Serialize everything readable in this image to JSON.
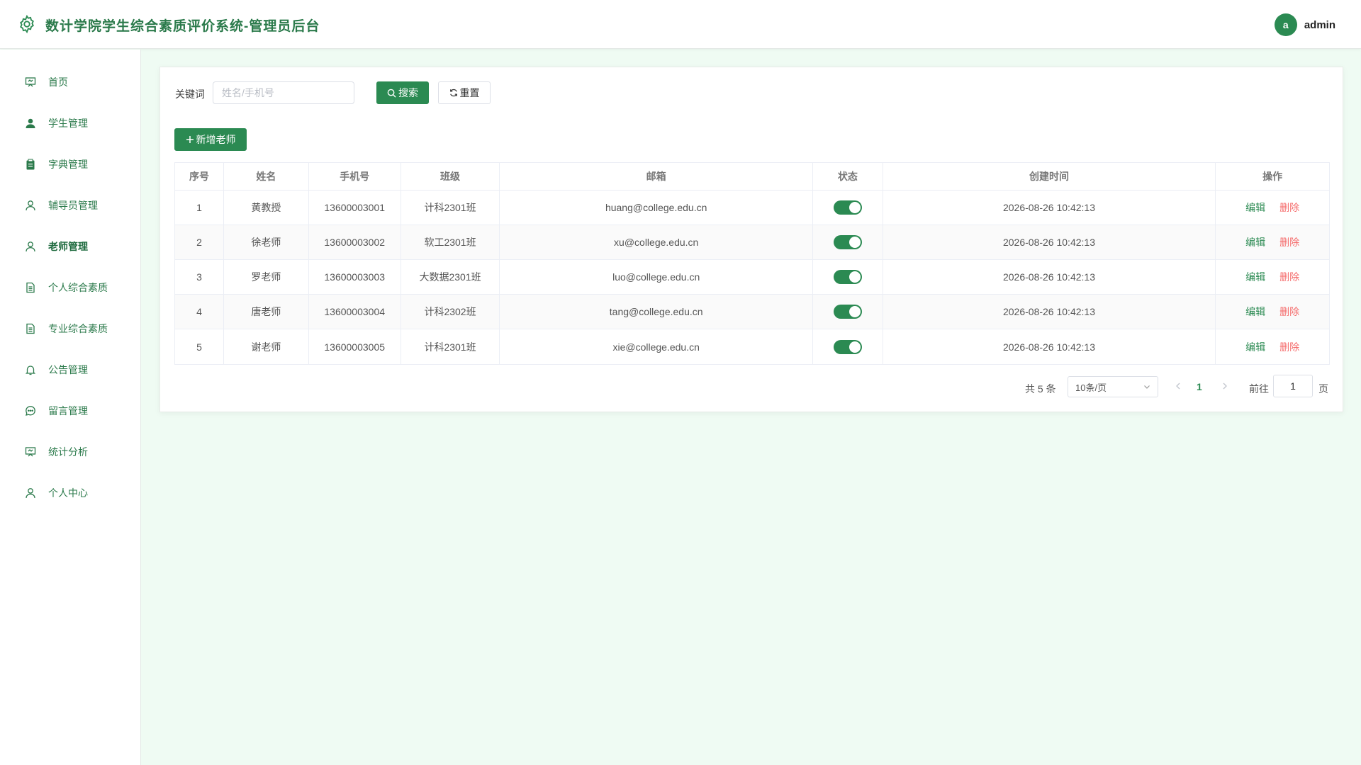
{
  "header": {
    "title": "数计学院学生综合素质评价系统-管理员后台",
    "avatar_letter": "a",
    "username": "admin"
  },
  "sidebar": {
    "items": [
      {
        "label": "首页",
        "icon": "presentation-icon"
      },
      {
        "label": "学生管理",
        "icon": "user-filled-icon"
      },
      {
        "label": "字典管理",
        "icon": "clipboard-icon"
      },
      {
        "label": "辅导员管理",
        "icon": "user-icon"
      },
      {
        "label": "老师管理",
        "icon": "user-icon",
        "active": true
      },
      {
        "label": "个人综合素质",
        "icon": "document-icon"
      },
      {
        "label": "专业综合素质",
        "icon": "document-icon"
      },
      {
        "label": "公告管理",
        "icon": "bell-icon"
      },
      {
        "label": "留言管理",
        "icon": "chat-icon"
      },
      {
        "label": "统计分析",
        "icon": "presentation-icon"
      },
      {
        "label": "个人中心",
        "icon": "user-icon"
      }
    ]
  },
  "search": {
    "label": "关键词",
    "placeholder": "姓名/手机号",
    "search_label": "搜索",
    "reset_label": "重置"
  },
  "add_button": "新增老师",
  "table": {
    "columns": [
      "序号",
      "姓名",
      "手机号",
      "班级",
      "邮箱",
      "状态",
      "创建时间",
      "操作"
    ],
    "rows": [
      {
        "no": "1",
        "name": "黄教授",
        "phone": "13600003001",
        "class": "计科2301班",
        "email": "huang@college.edu.cn",
        "enabled": true,
        "created": "2026-08-26 10:42:13"
      },
      {
        "no": "2",
        "name": "徐老师",
        "phone": "13600003002",
        "class": "软工2301班",
        "email": "xu@college.edu.cn",
        "enabled": true,
        "created": "2026-08-26 10:42:13"
      },
      {
        "no": "3",
        "name": "罗老师",
        "phone": "13600003003",
        "class": "大数据2301班",
        "email": "luo@college.edu.cn",
        "enabled": true,
        "created": "2026-08-26 10:42:13"
      },
      {
        "no": "4",
        "name": "唐老师",
        "phone": "13600003004",
        "class": "计科2302班",
        "email": "tang@college.edu.cn",
        "enabled": true,
        "created": "2026-08-26 10:42:13"
      },
      {
        "no": "5",
        "name": "谢老师",
        "phone": "13600003005",
        "class": "计科2301班",
        "email": "xie@college.edu.cn",
        "enabled": true,
        "created": "2026-08-26 10:42:13"
      }
    ],
    "edit_label": "编辑",
    "delete_label": "删除"
  },
  "pagination": {
    "total_text": "共 5 条",
    "page_size": "10条/页",
    "current_page": "1",
    "goto_label": "前往",
    "goto_value": "1",
    "page_suffix": "页"
  },
  "colors": {
    "primary": "#2b8a52",
    "danger": "#f56c6c",
    "background": "#effbf3"
  }
}
